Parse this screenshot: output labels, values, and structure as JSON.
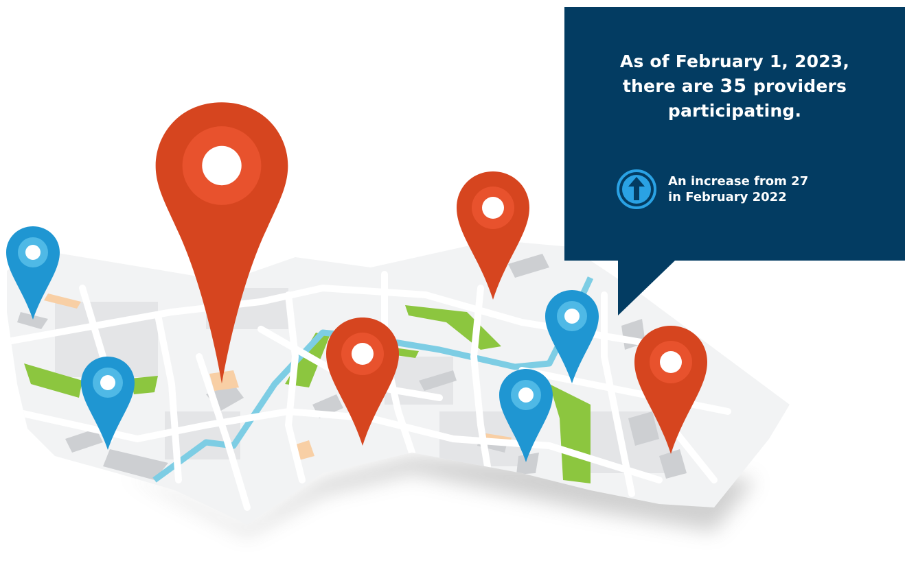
{
  "callout": {
    "line1": "As of February 1, 2023,",
    "line2_before": "there are",
    "count": "35",
    "line2_after": "providers",
    "line3": "participating.",
    "change_line1": "An increase from 27",
    "change_line2": "in February 2022"
  },
  "icons": {
    "change": "arrow-up-circle-icon"
  },
  "colors": {
    "callout_background": "#033c62",
    "icon_blue": "#2aa2e4",
    "pin_red": "#d6451f",
    "pin_blue": "#1f96d2",
    "park_green": "#7cbb2c",
    "river_blue": "#66c7dc"
  }
}
